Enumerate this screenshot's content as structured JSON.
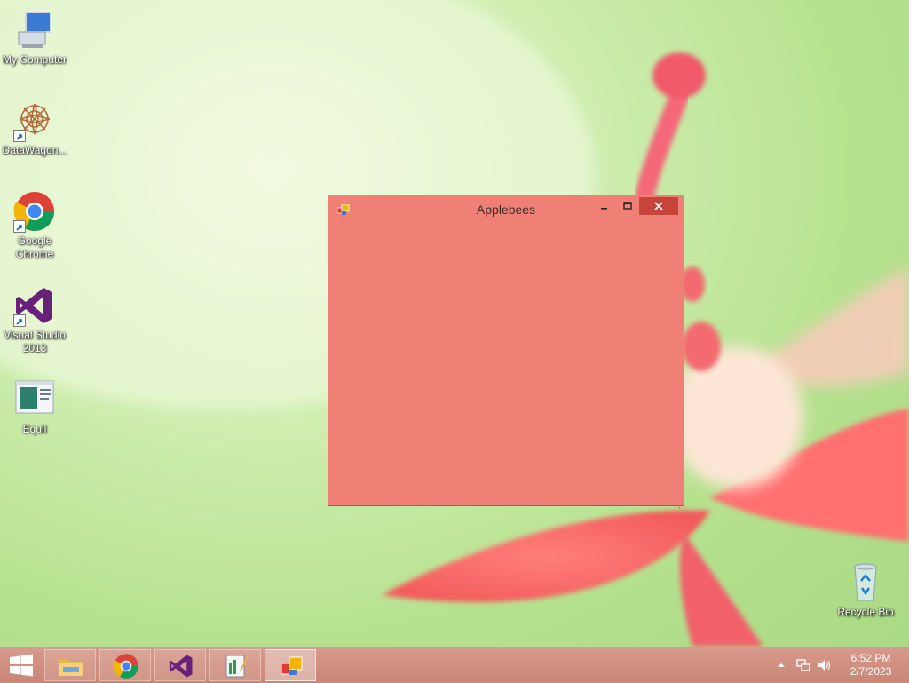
{
  "desktop": {
    "icons": [
      {
        "label": "My Computer",
        "icon": "computer-icon"
      },
      {
        "label": "DataWagon...",
        "icon": "datawagon-icon"
      },
      {
        "label": "Google\nChrome",
        "icon": "chrome-icon"
      },
      {
        "label": "Visual Studio\n2013",
        "icon": "visual-studio-icon"
      },
      {
        "label": "Equil",
        "icon": "equil-icon"
      },
      {
        "label": "Recycle Bin",
        "icon": "recycle-bin-icon"
      }
    ]
  },
  "window": {
    "title": "Applebees",
    "background_color": "#f08075",
    "controls": {
      "minimize": "minimize-icon",
      "maximize": "maximize-icon",
      "close": "close-icon"
    }
  },
  "taskbar": {
    "start": "windows-logo-icon",
    "pinned": [
      {
        "name": "File Explorer",
        "icon": "file-explorer-icon"
      },
      {
        "name": "Google Chrome",
        "icon": "chrome-icon"
      },
      {
        "name": "Visual Studio 2013",
        "icon": "visual-studio-icon"
      },
      {
        "name": "Equil",
        "icon": "equil-icon"
      },
      {
        "name": "Applebees",
        "icon": "app-window-icon",
        "active": true
      }
    ],
    "tray": {
      "time": "6:52 PM",
      "date": "2/7/2023"
    }
  },
  "colors": {
    "taskbar": "#cf9080",
    "window": "#f08075",
    "close_button": "#c7443a"
  }
}
